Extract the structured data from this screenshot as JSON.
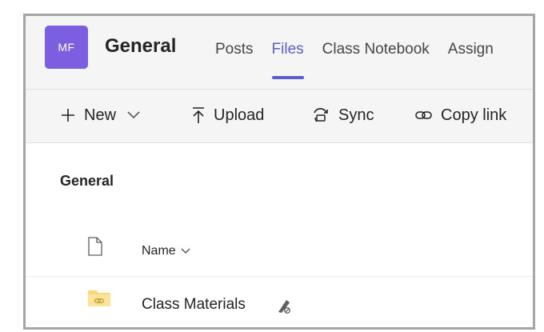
{
  "team": {
    "avatar_initials": "MF",
    "title": "General"
  },
  "tabs": [
    {
      "label": "Posts",
      "active": false
    },
    {
      "label": "Files",
      "active": true
    },
    {
      "label": "Class Notebook",
      "active": false
    },
    {
      "label": "Assign",
      "active": false
    }
  ],
  "toolbar": {
    "new_label": "New",
    "upload_label": "Upload",
    "sync_label": "Sync",
    "copy_link_label": "Copy link"
  },
  "content": {
    "section_title": "General",
    "columns": {
      "name": "Name"
    },
    "files": [
      {
        "name": "Class Materials",
        "type": "folder"
      }
    ]
  },
  "colors": {
    "accent": "#5b5fc7",
    "avatar": "#7b5fe0",
    "folder": "#f8d775"
  },
  "icons": [
    "plus-icon",
    "chevron-down-icon",
    "upload-icon",
    "sync-icon",
    "link-icon",
    "document-icon",
    "folder-icon",
    "class-materials-icon"
  ]
}
